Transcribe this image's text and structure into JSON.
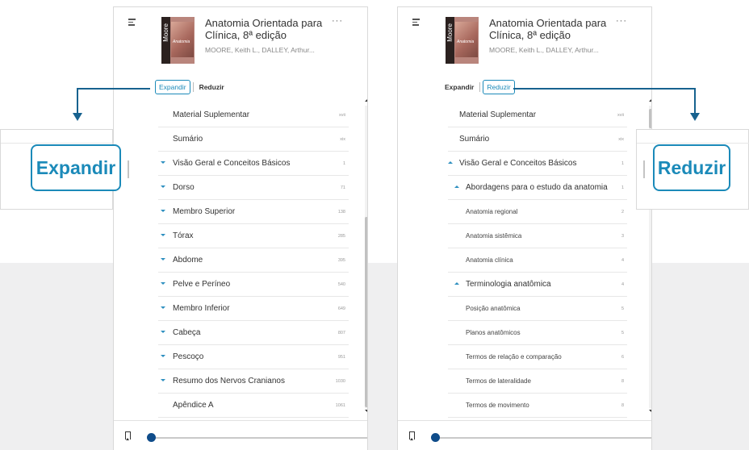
{
  "book": {
    "title": "Anatomia Orientada para Clínica, 8ª edição",
    "authors": "MOORE, Keith L., DALLEY, Arthur...",
    "cover_author": "Moore",
    "cover_title": "Anatomia",
    "more_label": "···"
  },
  "toggle": {
    "expand_label": "Expandir",
    "collapse_label": "Reduzir"
  },
  "callouts": {
    "expand_label": "Expandir",
    "collapse_label": "Reduzir"
  },
  "left_toc": [
    {
      "label": "Material Suplementar",
      "page": "xvii"
    },
    {
      "label": "Sumário",
      "page": "xix"
    },
    {
      "label": "Visão Geral e Conceitos Básicos",
      "page": "1"
    },
    {
      "label": "Dorso",
      "page": "71"
    },
    {
      "label": "Membro Superior",
      "page": "138"
    },
    {
      "label": "Tórax",
      "page": "285"
    },
    {
      "label": "Abdome",
      "page": "395"
    },
    {
      "label": "Pelve e Períneo",
      "page": "540"
    },
    {
      "label": "Membro Inferior",
      "page": "649"
    },
    {
      "label": "Cabeça",
      "page": "807"
    },
    {
      "label": "Pescoço",
      "page": "951"
    },
    {
      "label": "Resumo dos Nervos Cranianos",
      "page": "1030"
    },
    {
      "label": "Apêndice A",
      "page": "1061"
    }
  ],
  "right_toc": [
    {
      "label": "Material Suplementar",
      "page": "xvii"
    },
    {
      "label": "Sumário",
      "page": "xix"
    },
    {
      "label": "Visão Geral e Conceitos Básicos",
      "page": "1"
    },
    {
      "label": "Abordagens para o estudo da anatomia",
      "page": "1"
    },
    {
      "label": "Anatomia regional",
      "page": "2"
    },
    {
      "label": "Anatomia sistêmica",
      "page": "3"
    },
    {
      "label": "Anatomia clínica",
      "page": "4"
    },
    {
      "label": "Terminologia anatômica",
      "page": "4"
    },
    {
      "label": "Posição anatômica",
      "page": "5"
    },
    {
      "label": "Planos anatômicos",
      "page": "5"
    },
    {
      "label": "Termos de relação e comparação",
      "page": "6"
    },
    {
      "label": "Termos de lateralidade",
      "page": "8"
    },
    {
      "label": "Termos de movimento",
      "page": "8"
    }
  ],
  "icons": {
    "menu": "menu-icon",
    "bookmark": "bookmark-icon",
    "expand": "chevron-down-icon",
    "collapse": "chevron-up-icon"
  },
  "colors": {
    "accent": "#1b8ab9",
    "arrow": "#17628f",
    "progress": "#0f4c8a"
  },
  "reading_progress": 0.0
}
